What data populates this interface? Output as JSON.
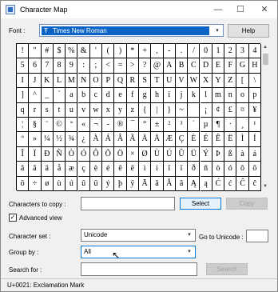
{
  "window": {
    "title": "Character Map"
  },
  "font": {
    "label": "Font :",
    "value": "Times New Roman",
    "help_label": "Help"
  },
  "grid": {
    "rows": [
      [
        "!",
        "\"",
        "#",
        "$",
        "%",
        "&",
        "'",
        "(",
        ")",
        "*",
        "+",
        ",",
        "-",
        ".",
        "/",
        "0",
        "1",
        "2",
        "3",
        "4"
      ],
      [
        "5",
        "6",
        "7",
        "8",
        "9",
        ":",
        ";",
        "<",
        "=",
        ">",
        "?",
        "@",
        "A",
        "B",
        "C",
        "D",
        "E",
        "F",
        "G",
        "H"
      ],
      [
        "I",
        "J",
        "K",
        "L",
        "M",
        "N",
        "O",
        "P",
        "Q",
        "R",
        "S",
        "T",
        "U",
        "V",
        "W",
        "X",
        "Y",
        "Z",
        "[",
        "\\"
      ],
      [
        "]",
        "^",
        "_",
        "`",
        "a",
        "b",
        "c",
        "d",
        "e",
        "f",
        "g",
        "h",
        "i",
        "j",
        "k",
        "l",
        "m",
        "n",
        "o",
        "p"
      ],
      [
        "q",
        "r",
        "s",
        "t",
        "u",
        "v",
        "w",
        "x",
        "y",
        "z",
        "{",
        "|",
        "}",
        "~",
        "",
        "¡",
        "¢",
        "£",
        "¤",
        "¥"
      ],
      [
        "¦",
        "§",
        "¨",
        "©",
        "ª",
        "«",
        "¬",
        "-",
        "®",
        "¯",
        "°",
        "±",
        "²",
        "³",
        "´",
        "µ",
        "¶",
        "·",
        "¸",
        "¹"
      ],
      [
        "º",
        "»",
        "¼",
        "½",
        "¾",
        "¿",
        "À",
        "Á",
        "Â",
        "Ã",
        "Ä",
        "Å",
        "Æ",
        "Ç",
        "È",
        "É",
        "Ê",
        "Ë",
        "Ì",
        "Í"
      ],
      [
        "Î",
        "Ï",
        "Ð",
        "Ñ",
        "Ò",
        "Ó",
        "Ô",
        "Õ",
        "Ö",
        "×",
        "Ø",
        "Ù",
        "Ú",
        "Û",
        "Ü",
        "Ý",
        "Þ",
        "ß",
        "à",
        "á"
      ],
      [
        "â",
        "ã",
        "ä",
        "å",
        "æ",
        "ç",
        "è",
        "é",
        "ê",
        "ë",
        "ì",
        "í",
        "î",
        "ï",
        "ð",
        "ñ",
        "ò",
        "ó",
        "ô",
        "õ"
      ],
      [
        "ö",
        "÷",
        "ø",
        "ù",
        "ú",
        "û",
        "ü",
        "ý",
        "þ",
        "ÿ",
        "Ā",
        "ā",
        "Ă",
        "ă",
        "Ą",
        "ą",
        "Ć",
        "ć",
        "Ĉ",
        "ĉ"
      ]
    ]
  },
  "copy": {
    "label": "Characters to copy :",
    "value": "",
    "select_label": "Select",
    "copy_label": "Copy"
  },
  "advanced_view": {
    "label": "Advanced view",
    "checked": true,
    "mark": "✓"
  },
  "character_set": {
    "label": "Character set :",
    "value": "Unicode"
  },
  "go_to_unicode": {
    "label": "Go to Unicode :",
    "value": ""
  },
  "group_by": {
    "label": "Group by :",
    "value": "All"
  },
  "search": {
    "label": "Search for :",
    "value": "",
    "button_label": "Search"
  },
  "status": {
    "text": "U+0021: Exclamation Mark"
  },
  "icons": {
    "minimize": "—",
    "maximize": "☐",
    "close": "✕",
    "dropdown": "▾",
    "scroll_up": "▲",
    "scroll_down": "▼",
    "cursor": "↖"
  }
}
